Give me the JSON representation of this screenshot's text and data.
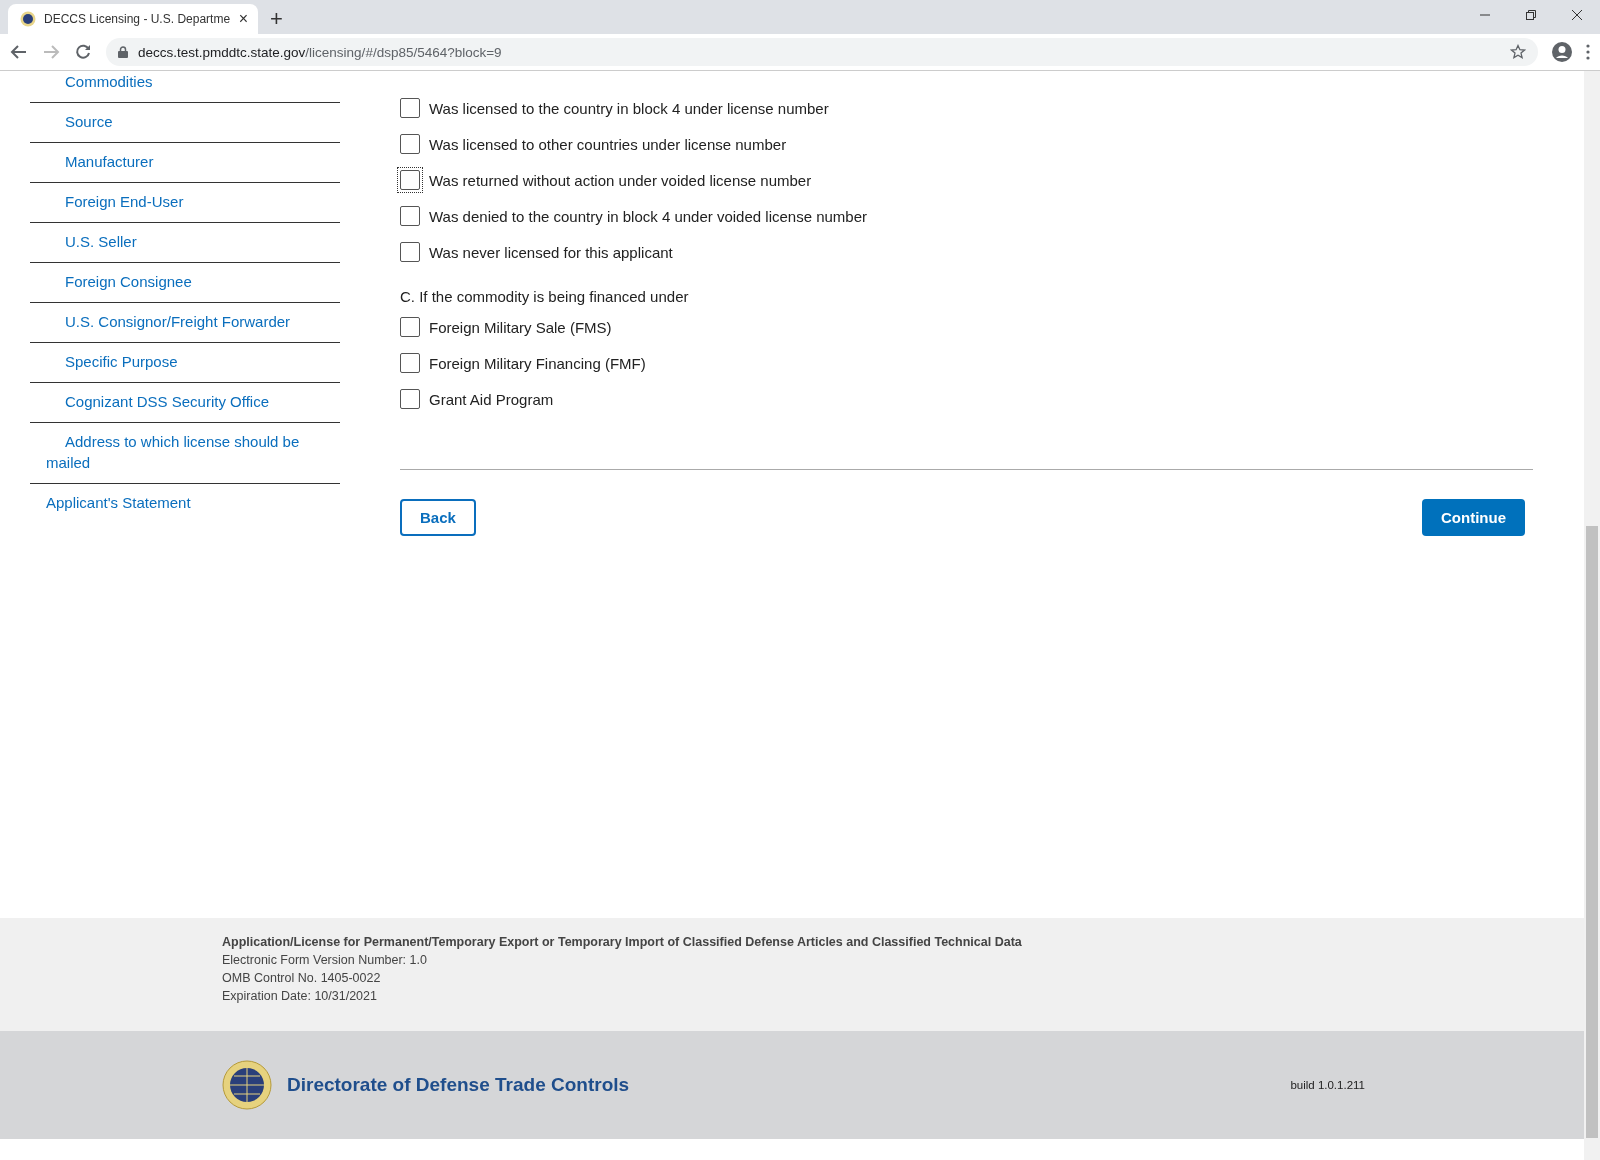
{
  "browser": {
    "tab_title": "DECCS Licensing - U.S. Departme",
    "tab_close": "×",
    "new_tab": "+",
    "url_host": "deccs.test.pmddtc.state.gov",
    "url_path": "/licensing/#/dsp85/5464?block=9"
  },
  "sidebar": {
    "items": [
      {
        "label": "Commodities",
        "kind": "sub"
      },
      {
        "label": "Source",
        "kind": "sub"
      },
      {
        "label": "Manufacturer",
        "kind": "sub"
      },
      {
        "label": "Foreign End-User",
        "kind": "sub"
      },
      {
        "label": "U.S. Seller",
        "kind": "sub"
      },
      {
        "label": "Foreign Consignee",
        "kind": "sub"
      },
      {
        "label": "U.S. Consignor/Freight Forwarder",
        "kind": "sub"
      },
      {
        "label": "Specific Purpose",
        "kind": "sub"
      },
      {
        "label": "Cognizant DSS Security Office",
        "kind": "sub"
      },
      {
        "label": "Address to which license should be mailed",
        "kind": "sub"
      },
      {
        "label": "Applicant's Statement",
        "kind": "top"
      }
    ]
  },
  "license_history": [
    {
      "label": "Was licensed to the country in block 4 under license number",
      "checked": false,
      "focused": false
    },
    {
      "label": "Was licensed to other countries under license number",
      "checked": false,
      "focused": false
    },
    {
      "label": "Was returned without action under voided license number",
      "checked": false,
      "focused": true
    },
    {
      "label": "Was denied to the country in block 4 under voided license number",
      "checked": false,
      "focused": false
    },
    {
      "label": "Was never licensed for this applicant",
      "checked": false,
      "focused": false
    }
  ],
  "financing": {
    "heading": "C. If the commodity is being financed under",
    "options": [
      {
        "label": "Foreign Military Sale (FMS)",
        "checked": false,
        "focused": false
      },
      {
        "label": "Foreign Military Financing (FMF)",
        "checked": false,
        "focused": false
      },
      {
        "label": "Grant Aid Program",
        "checked": false,
        "focused": false
      }
    ]
  },
  "buttons": {
    "back": "Back",
    "continue": "Continue"
  },
  "footer": {
    "form_title": "Application/License for Permanent/Temporary Export or Temporary Import of Classified Defense Articles and Classified Technical Data",
    "lines": [
      "Electronic Form Version Number: 1.0",
      "OMB Control No. 1405-0022",
      "Expiration Date: 10/31/2021"
    ],
    "org_name": "Directorate of Defense Trade Controls",
    "build": "build 1.0.1.211"
  }
}
